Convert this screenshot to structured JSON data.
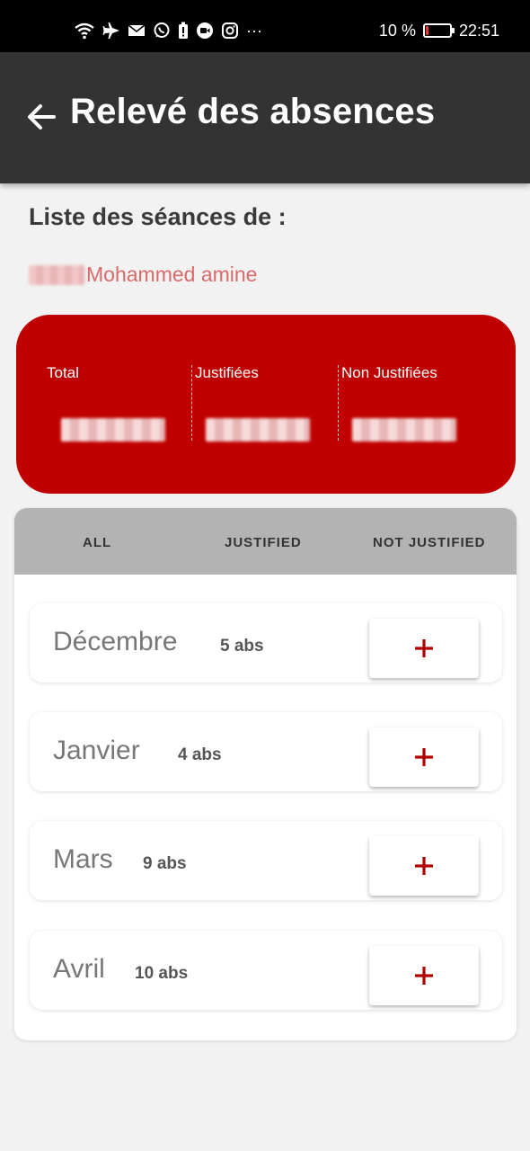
{
  "status_bar": {
    "battery": "10 %",
    "battery_level": 0.1,
    "time": "22:51",
    "more": "···"
  },
  "app_bar": {
    "title": "Relevé des absences"
  },
  "heading": "Liste des séances de :",
  "student": {
    "name": "Mohammed amine"
  },
  "stats": {
    "total_label": "Total",
    "justified_label": "Justifiées",
    "unjustified_label": "Non Justifiées"
  },
  "tabs": [
    "ALL",
    "JUSTIFIED",
    "NOT JUSTIFIED"
  ],
  "months": [
    {
      "name": "Décembre",
      "count": "5 abs"
    },
    {
      "name": "Janvier",
      "count": "4 abs"
    },
    {
      "name": "Mars",
      "count": "9 abs"
    },
    {
      "name": "Avril",
      "count": "10 abs"
    }
  ],
  "colors": {
    "accent": "#c00000",
    "app_bar": "#333333",
    "tabs_bg": "#b3b3b3",
    "name": "#d96a6a"
  }
}
